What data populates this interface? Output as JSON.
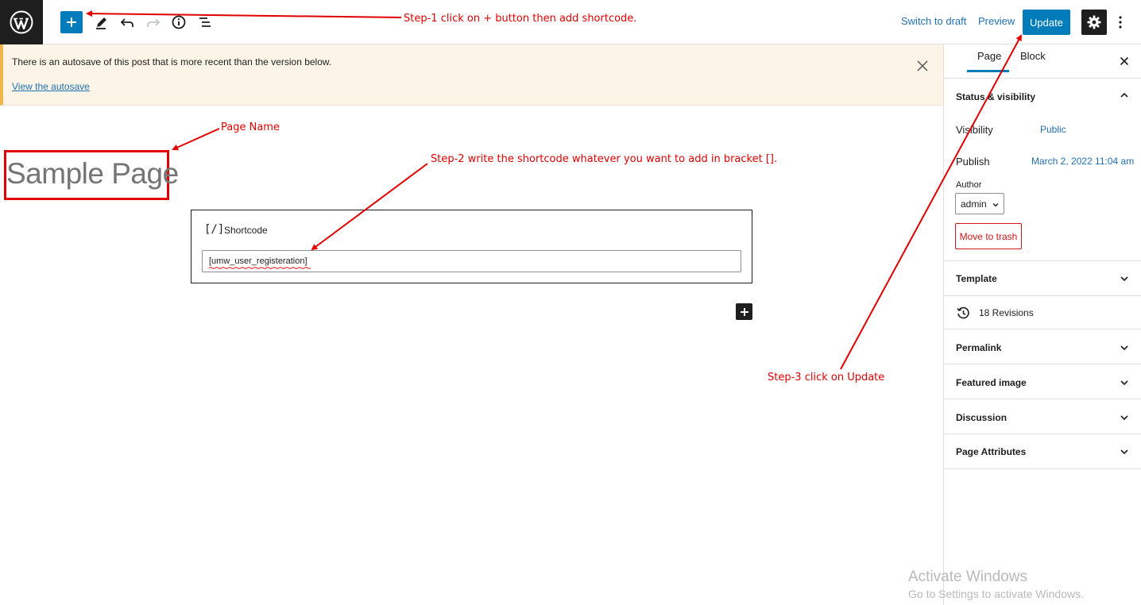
{
  "toolbar": {
    "logo_icon": "wordpress-logo",
    "add_icon": "plus-icon",
    "tools_icon": "pencil-icon",
    "undo_icon": "undo-icon",
    "redo_icon": "redo-icon",
    "info_icon": "info-icon",
    "list_view_icon": "list-view-icon",
    "switch_to_draft": "Switch to draft",
    "preview": "Preview",
    "update": "Update",
    "settings_icon": "gear-icon",
    "more_icon": "more-vertical-icon",
    "accent_color": "#007cba"
  },
  "notice": {
    "text": "There is an autosave of this post that is more recent than the version below.",
    "link": "View the autosave",
    "close_icon": "close-icon"
  },
  "editor": {
    "page_title": "Sample Page",
    "block": {
      "icon": "[/]",
      "label": "Shortcode",
      "value": "[umw_user_registeration]"
    },
    "inserter_icon": "plus-icon"
  },
  "sidebar": {
    "tabs": [
      {
        "label": "Page",
        "active": true
      },
      {
        "label": "Block",
        "active": false
      }
    ],
    "close_icon": "close-icon",
    "status_panel": {
      "title": "Status & visibility",
      "visibility_label": "Visibility",
      "visibility_value": "Public",
      "publish_label": "Publish",
      "publish_value": "March 2, 2022 11:04 am",
      "author_label": "Author",
      "author_value": "admin",
      "trash_label": "Move to trash"
    },
    "panels": [
      {
        "title": "Template"
      },
      {
        "title": "18 Revisions"
      },
      {
        "title": "Permalink"
      },
      {
        "title": "Featured image"
      },
      {
        "title": "Discussion"
      },
      {
        "title": "Page Attributes"
      }
    ]
  },
  "annotations": {
    "step1": "Step-1 click on + button then add shortcode.",
    "page_name": "Page Name",
    "step2": "Step-2 write the shortcode whatever you want to add in bracket [].",
    "step3": "Step-3 click on Update",
    "color": "#e00000"
  },
  "watermark": {
    "title": "Activate Windows",
    "subtitle": "Go to Settings to activate Windows."
  }
}
